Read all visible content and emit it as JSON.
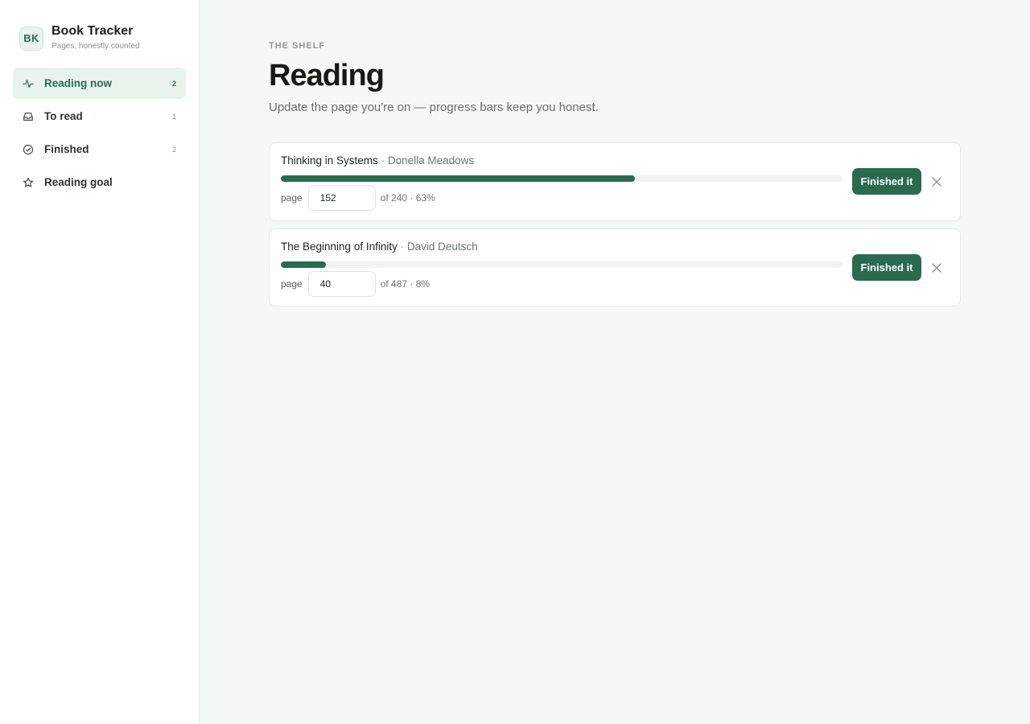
{
  "app": {
    "logo_text": "BK",
    "title": "Book Tracker",
    "subtitle": "Pages, honestly counted"
  },
  "sidebar": {
    "items": [
      {
        "label": "Reading now",
        "count": "2",
        "icon": "activity-icon",
        "active": true
      },
      {
        "label": "To read",
        "count": "1",
        "icon": "inbox-icon",
        "active": false
      },
      {
        "label": "Finished",
        "count": "2",
        "icon": "check-circle-icon",
        "active": false
      },
      {
        "label": "Reading goal",
        "count": "",
        "icon": "star-icon",
        "active": false
      }
    ]
  },
  "main": {
    "eyebrow": "THE SHELF",
    "title": "Reading",
    "description": "Update the page you're on — progress bars keep you honest."
  },
  "books": [
    {
      "title": "Thinking in Systems",
      "separator": "·",
      "author": "Donella Meadows",
      "page_label": "page",
      "current_page": "152",
      "of_text": "of 240 · 63%",
      "progress": 0.63,
      "finish_label": "Finished it"
    },
    {
      "title": "The Beginning of Infinity",
      "separator": "·",
      "author": "David Deutsch",
      "page_label": "page",
      "current_page": "40",
      "of_text": "of 487 · 8%",
      "progress": 0.08,
      "finish_label": "Finished it"
    }
  ],
  "colors": {
    "accent": "#2a6b50",
    "accent_soft": "#e8f3ed",
    "background": "#f6f8f7"
  }
}
